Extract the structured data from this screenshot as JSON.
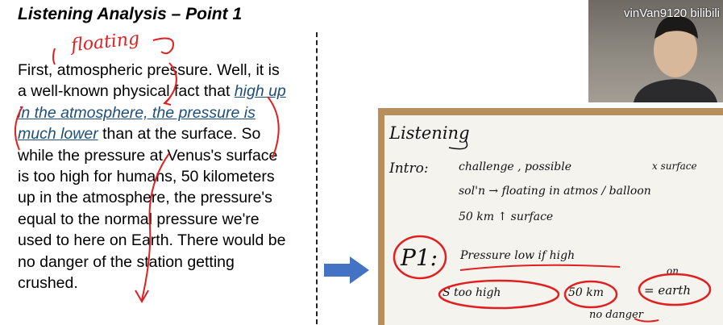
{
  "slide": {
    "title": "Listening Analysis – Point 1",
    "passage_before": "First, atmospheric pressure. Well, it is a well-known physical fact that ",
    "passage_highlight": "high up in the atmosphere, the pressure is much lower",
    "passage_after": " than at the surface. So while the pressure at Venus's surface is too high for humans, 50 kilometers up in the atmosphere, the pressure's equal to the normal pressure we're used to here on Earth. There would be no danger of the station getting crushed.",
    "annotation": "floating"
  },
  "video": {
    "channel_text": "vinVan9120 bilibili"
  },
  "notes": {
    "heading": "Listening",
    "intro_label": "Intro:",
    "intro_line1": "challenge , possible",
    "intro_x_surface": "x surface",
    "intro_line2": "sol'n → floating in atmos / balloon",
    "intro_line3": "50 km ↑ surface",
    "p1_label": "P1:",
    "p1_line1": "Pressure low if high",
    "p1_s": "S too high",
    "p1_50km": "50 km",
    "p1_on": "on",
    "p1_earth": "= earth",
    "p1_no_danger": "no danger"
  },
  "colors": {
    "highlight_text": "#1f4e79",
    "ink_red": "#e02020",
    "arrow_blue": "#4472c4"
  },
  "icons": [
    "arrow-right-icon"
  ]
}
